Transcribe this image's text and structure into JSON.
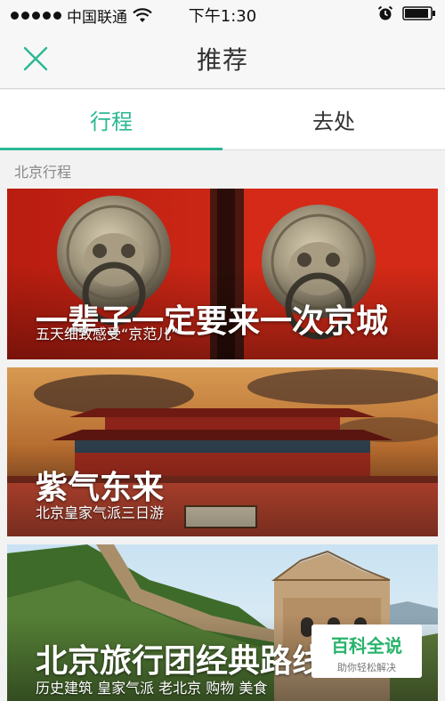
{
  "status_bar": {
    "carrier": "中国联通",
    "time": "下午1:30"
  },
  "nav": {
    "title": "推荐",
    "close_icon": "close-icon"
  },
  "tabs": [
    {
      "label": "行程",
      "active": true
    },
    {
      "label": "去处",
      "active": false
    }
  ],
  "section_label": "北京行程",
  "cards": [
    {
      "title": "一辈子一定要来一次京城",
      "subtitle": "五天细致感受“京范儿”"
    },
    {
      "title": "紫气东来",
      "subtitle": "北京皇家气派三日游"
    },
    {
      "title": "北京旅行团经典路线",
      "subtitle": "历史建筑 皇家气派 老北京 购物 美食"
    }
  ],
  "watermark": {
    "main": "百科全说",
    "sub": "助你轻松解决"
  },
  "colors": {
    "accent": "#2bb894",
    "watermark_green": "#27b36a"
  }
}
